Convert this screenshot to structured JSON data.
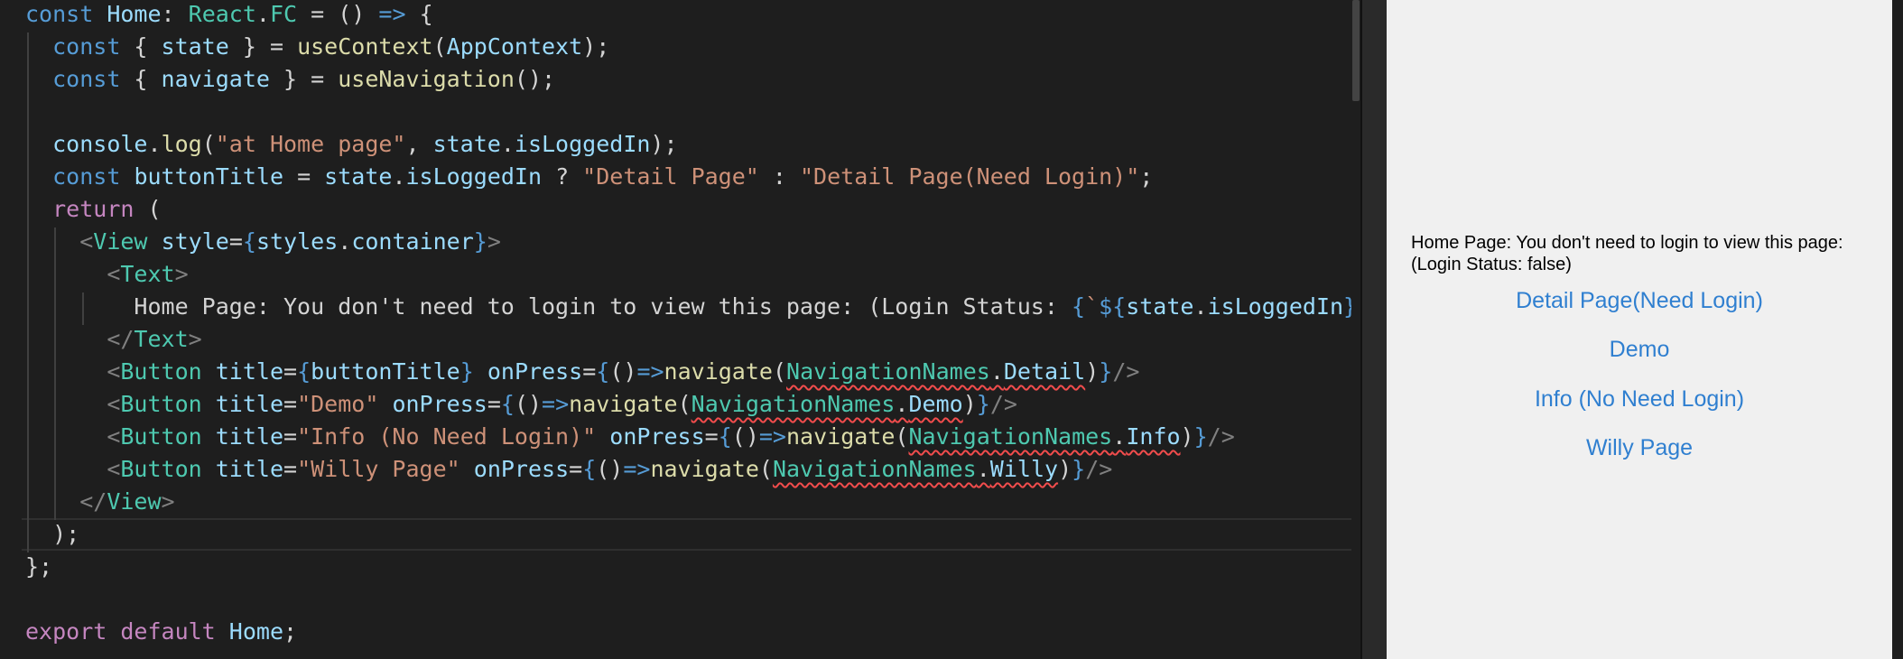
{
  "editor": {
    "code_lines": [
      [
        {
          "t": "const",
          "c": "kw"
        },
        {
          "t": " "
        },
        {
          "t": "Home",
          "c": "var"
        },
        {
          "t": ": "
        },
        {
          "t": "React",
          "c": "cls"
        },
        {
          "t": "."
        },
        {
          "t": "FC",
          "c": "cls"
        },
        {
          "t": " = () "
        },
        {
          "t": "=>",
          "c": "kw"
        },
        {
          "t": " {"
        }
      ],
      [
        {
          "t": "  "
        },
        {
          "t": "const",
          "c": "kw"
        },
        {
          "t": " { "
        },
        {
          "t": "state",
          "c": "var"
        },
        {
          "t": " } = "
        },
        {
          "t": "useContext",
          "c": "fn"
        },
        {
          "t": "("
        },
        {
          "t": "AppContext",
          "c": "var"
        },
        {
          "t": ");"
        }
      ],
      [
        {
          "t": "  "
        },
        {
          "t": "const",
          "c": "kw"
        },
        {
          "t": " { "
        },
        {
          "t": "navigate",
          "c": "var"
        },
        {
          "t": " } = "
        },
        {
          "t": "useNavigation",
          "c": "fn"
        },
        {
          "t": "();"
        }
      ],
      [],
      [
        {
          "t": "  "
        },
        {
          "t": "console",
          "c": "var"
        },
        {
          "t": "."
        },
        {
          "t": "log",
          "c": "fn"
        },
        {
          "t": "("
        },
        {
          "t": "\"at Home page\"",
          "c": "str"
        },
        {
          "t": ", "
        },
        {
          "t": "state",
          "c": "var"
        },
        {
          "t": "."
        },
        {
          "t": "isLoggedIn",
          "c": "var"
        },
        {
          "t": ");"
        }
      ],
      [
        {
          "t": "  "
        },
        {
          "t": "const",
          "c": "kw"
        },
        {
          "t": " "
        },
        {
          "t": "buttonTitle",
          "c": "var"
        },
        {
          "t": " = "
        },
        {
          "t": "state",
          "c": "var"
        },
        {
          "t": "."
        },
        {
          "t": "isLoggedIn",
          "c": "var"
        },
        {
          "t": " ? "
        },
        {
          "t": "\"Detail Page\"",
          "c": "str"
        },
        {
          "t": " : "
        },
        {
          "t": "\"Detail Page(Need Login)\"",
          "c": "str"
        },
        {
          "t": ";"
        }
      ],
      [
        {
          "t": "  "
        },
        {
          "t": "return",
          "c": "kw2"
        },
        {
          "t": " ("
        }
      ],
      [
        {
          "t": "    "
        },
        {
          "t": "<",
          "c": "ang"
        },
        {
          "t": "View",
          "c": "tag"
        },
        {
          "t": " "
        },
        {
          "t": "style",
          "c": "var"
        },
        {
          "t": "="
        },
        {
          "t": "{",
          "c": "brc"
        },
        {
          "t": "styles",
          "c": "var"
        },
        {
          "t": "."
        },
        {
          "t": "container",
          "c": "var"
        },
        {
          "t": "}",
          "c": "brc"
        },
        {
          "t": ">",
          "c": "ang"
        }
      ],
      [
        {
          "t": "      "
        },
        {
          "t": "<",
          "c": "ang"
        },
        {
          "t": "Text",
          "c": "tag"
        },
        {
          "t": ">",
          "c": "ang"
        }
      ],
      [
        {
          "t": "        "
        },
        {
          "t": "Home Page: You don't need to login to view this page: (Login Status: ",
          "c": "txt"
        },
        {
          "t": "{",
          "c": "brc"
        },
        {
          "t": "`",
          "c": "str"
        },
        {
          "t": "${",
          "c": "brc"
        },
        {
          "t": "state",
          "c": "var"
        },
        {
          "t": "."
        },
        {
          "t": "isLoggedIn",
          "c": "var"
        },
        {
          "t": "}",
          "c": "brc"
        },
        {
          "t": "`",
          "c": "str"
        },
        {
          "t": "}",
          "c": "brc"
        },
        {
          "t": ")",
          "c": "txt"
        }
      ],
      [
        {
          "t": "      "
        },
        {
          "t": "</",
          "c": "ang"
        },
        {
          "t": "Text",
          "c": "tag"
        },
        {
          "t": ">",
          "c": "ang"
        }
      ],
      [
        {
          "t": "      "
        },
        {
          "t": "<",
          "c": "ang"
        },
        {
          "t": "Button",
          "c": "tag"
        },
        {
          "t": " "
        },
        {
          "t": "title",
          "c": "var"
        },
        {
          "t": "="
        },
        {
          "t": "{",
          "c": "brc"
        },
        {
          "t": "buttonTitle",
          "c": "var"
        },
        {
          "t": "}",
          "c": "brc"
        },
        {
          "t": " "
        },
        {
          "t": "onPress",
          "c": "var"
        },
        {
          "t": "="
        },
        {
          "t": "{",
          "c": "brc"
        },
        {
          "t": "()"
        },
        {
          "t": "=>",
          "c": "kw"
        },
        {
          "t": "navigate",
          "c": "fn"
        },
        {
          "t": "("
        },
        {
          "t": "NavigationNames",
          "c": "cls",
          "e": 1
        },
        {
          "t": ".",
          "e": 1
        },
        {
          "t": "Detail",
          "c": "var",
          "e": 1
        },
        {
          "t": ")"
        },
        {
          "t": "}",
          "c": "brc"
        },
        {
          "t": "/>",
          "c": "ang"
        }
      ],
      [
        {
          "t": "      "
        },
        {
          "t": "<",
          "c": "ang"
        },
        {
          "t": "Button",
          "c": "tag"
        },
        {
          "t": " "
        },
        {
          "t": "title",
          "c": "var"
        },
        {
          "t": "="
        },
        {
          "t": "\"Demo\"",
          "c": "str"
        },
        {
          "t": " "
        },
        {
          "t": "onPress",
          "c": "var"
        },
        {
          "t": "="
        },
        {
          "t": "{",
          "c": "brc"
        },
        {
          "t": "()"
        },
        {
          "t": "=>",
          "c": "kw"
        },
        {
          "t": "navigate",
          "c": "fn"
        },
        {
          "t": "("
        },
        {
          "t": "NavigationNames",
          "c": "cls",
          "e": 1
        },
        {
          "t": ".",
          "e": 1
        },
        {
          "t": "Demo",
          "c": "var",
          "e": 1
        },
        {
          "t": ")"
        },
        {
          "t": "}",
          "c": "brc"
        },
        {
          "t": "/>",
          "c": "ang"
        }
      ],
      [
        {
          "t": "      "
        },
        {
          "t": "<",
          "c": "ang"
        },
        {
          "t": "Button",
          "c": "tag"
        },
        {
          "t": " "
        },
        {
          "t": "title",
          "c": "var"
        },
        {
          "t": "="
        },
        {
          "t": "\"Info (No Need Login)\"",
          "c": "str"
        },
        {
          "t": " "
        },
        {
          "t": "onPress",
          "c": "var"
        },
        {
          "t": "="
        },
        {
          "t": "{",
          "c": "brc"
        },
        {
          "t": "()"
        },
        {
          "t": "=>",
          "c": "kw"
        },
        {
          "t": "navigate",
          "c": "fn"
        },
        {
          "t": "("
        },
        {
          "t": "NavigationNames",
          "c": "cls",
          "e": 1
        },
        {
          "t": ".",
          "e": 1
        },
        {
          "t": "Info",
          "c": "var",
          "e": 1
        },
        {
          "t": ")"
        },
        {
          "t": "}",
          "c": "brc"
        },
        {
          "t": "/>",
          "c": "ang"
        }
      ],
      [
        {
          "t": "      "
        },
        {
          "t": "<",
          "c": "ang"
        },
        {
          "t": "Button",
          "c": "tag"
        },
        {
          "t": " "
        },
        {
          "t": "title",
          "c": "var"
        },
        {
          "t": "="
        },
        {
          "t": "\"Willy Page\"",
          "c": "str"
        },
        {
          "t": " "
        },
        {
          "t": "onPress",
          "c": "var"
        },
        {
          "t": "="
        },
        {
          "t": "{",
          "c": "brc"
        },
        {
          "t": "()"
        },
        {
          "t": "=>",
          "c": "kw"
        },
        {
          "t": "navigate",
          "c": "fn"
        },
        {
          "t": "("
        },
        {
          "t": "NavigationNames",
          "c": "cls",
          "e": 1
        },
        {
          "t": ".",
          "e": 1
        },
        {
          "t": "Willy",
          "c": "var",
          "e": 1
        },
        {
          "t": ")"
        },
        {
          "t": "}",
          "c": "brc"
        },
        {
          "t": "/>",
          "c": "ang"
        }
      ],
      [
        {
          "t": "    "
        },
        {
          "t": "</",
          "c": "ang"
        },
        {
          "t": "View",
          "c": "tag"
        },
        {
          "t": ">",
          "c": "ang"
        }
      ],
      [
        {
          "t": "  );"
        }
      ],
      [
        {
          "t": "};"
        }
      ],
      [],
      [
        {
          "t": "export",
          "c": "kw2"
        },
        {
          "t": " "
        },
        {
          "t": "default",
          "c": "kw2"
        },
        {
          "t": " "
        },
        {
          "t": "Home",
          "c": "var"
        },
        {
          "t": ";"
        }
      ]
    ]
  },
  "preview": {
    "message_line1": "Home Page: You don't need to login to view this page:",
    "message_line2": "(Login Status: false)",
    "buttons": [
      {
        "label": "Detail Page(Need Login)"
      },
      {
        "label": "Demo"
      },
      {
        "label": "Info (No Need Login)"
      },
      {
        "label": "Willy Page"
      }
    ],
    "button_color": "#2f7fd0"
  },
  "theme": {
    "editor_bg": "#1e1e1e",
    "preview_bg": "#f0f0f0"
  }
}
